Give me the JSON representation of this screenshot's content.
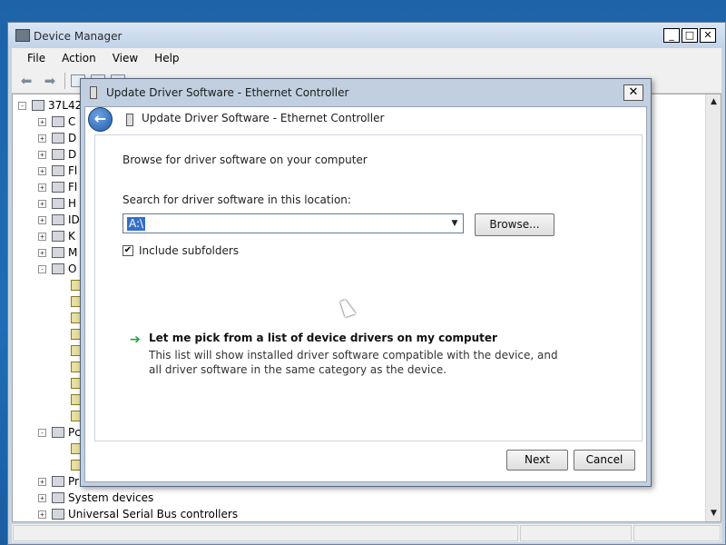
{
  "device_manager": {
    "title": "Device Manager",
    "menu": [
      "File",
      "Action",
      "View",
      "Help"
    ],
    "tree": {
      "root_label": "37L42",
      "visible_items": [
        {
          "label": "C",
          "expander": "+"
        },
        {
          "label": "D",
          "expander": "+"
        },
        {
          "label": "D",
          "expander": "+"
        },
        {
          "label": "Fl",
          "expander": "+"
        },
        {
          "label": "Fl",
          "expander": "+"
        },
        {
          "label": "H",
          "expander": "+"
        },
        {
          "label": "ID",
          "expander": "+"
        },
        {
          "label": "K",
          "expander": "+"
        },
        {
          "label": "M",
          "expander": "+"
        },
        {
          "label": "O",
          "expander": "-"
        },
        {
          "label": "Pc",
          "expander": "-"
        },
        {
          "label": "Pr",
          "expander": "+"
        },
        {
          "label": "System devices",
          "expander": "+"
        },
        {
          "label": "Universal Serial Bus controllers",
          "expander": "+"
        }
      ]
    }
  },
  "dialog": {
    "title": "Update Driver Software - Ethernet Controller",
    "header_title": "Update Driver Software - Ethernet Controller",
    "heading": "Browse for driver software on your computer",
    "search_label": "Search for driver software in this location:",
    "path_value": "A:\\",
    "browse_label": "Browse...",
    "include_subfolders_label": "Include subfolders",
    "include_subfolders_checked": "✔",
    "pick_title": "Let me pick from a list of device drivers on my computer",
    "pick_desc": "This list will show installed driver software compatible with the device, and all driver software in the same category as the device.",
    "next_label": "Next",
    "cancel_label": "Cancel",
    "close_glyph": "✕",
    "back_glyph": "←"
  }
}
